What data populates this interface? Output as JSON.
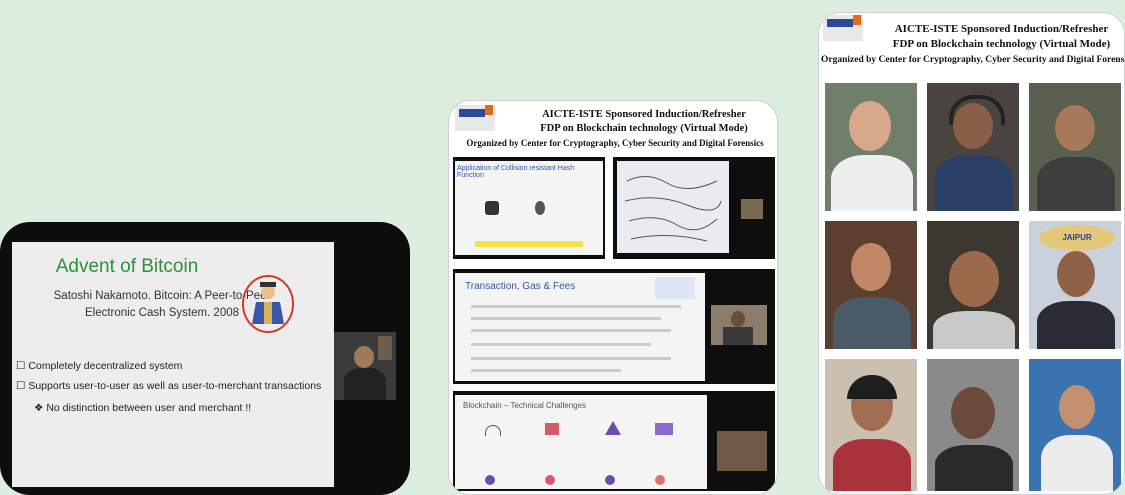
{
  "left_slide": {
    "title": "Advent of Bitcoin",
    "subtitle": "Satoshi Nakamoto. Bitcoin: A Peer-to-Peer Electronic Cash System. 2008",
    "bullets": [
      "Completely decentralized system",
      "Supports user-to-user as well as user-to-merchant transactions",
      "No distinction between user and merchant !!"
    ]
  },
  "middle_card": {
    "header_line1": "AICTE-ISTE Sponsored Induction/Refresher",
    "header_line2": "FDP on Blockchain technology (Virtual Mode)",
    "header_line3": "Organized by Center for Cryptography, Cyber Security and Digital Forensics",
    "logo_text": "MIIT",
    "slide1_title": "Application of Collision resistant Hash Function",
    "slide3_title": "Transaction, Gas & Fees",
    "slide4_title": "Blockchain – Technical Challenges"
  },
  "right_card": {
    "header_line1": "AICTE-ISTE Sponsored Induction/Refresher",
    "header_line2": "FDP on Blockchain technology (Virtual Mode)",
    "header_line3": "Organized by Center for Cryptography, Cyber Security and Digital Forensics",
    "logo_text": "MIIT",
    "sign_text": "JAIPUR"
  },
  "colors": {
    "background": "#dceee0",
    "slide_title_green": "#2f8f3a",
    "dark_frame": "#0d0d0d"
  }
}
